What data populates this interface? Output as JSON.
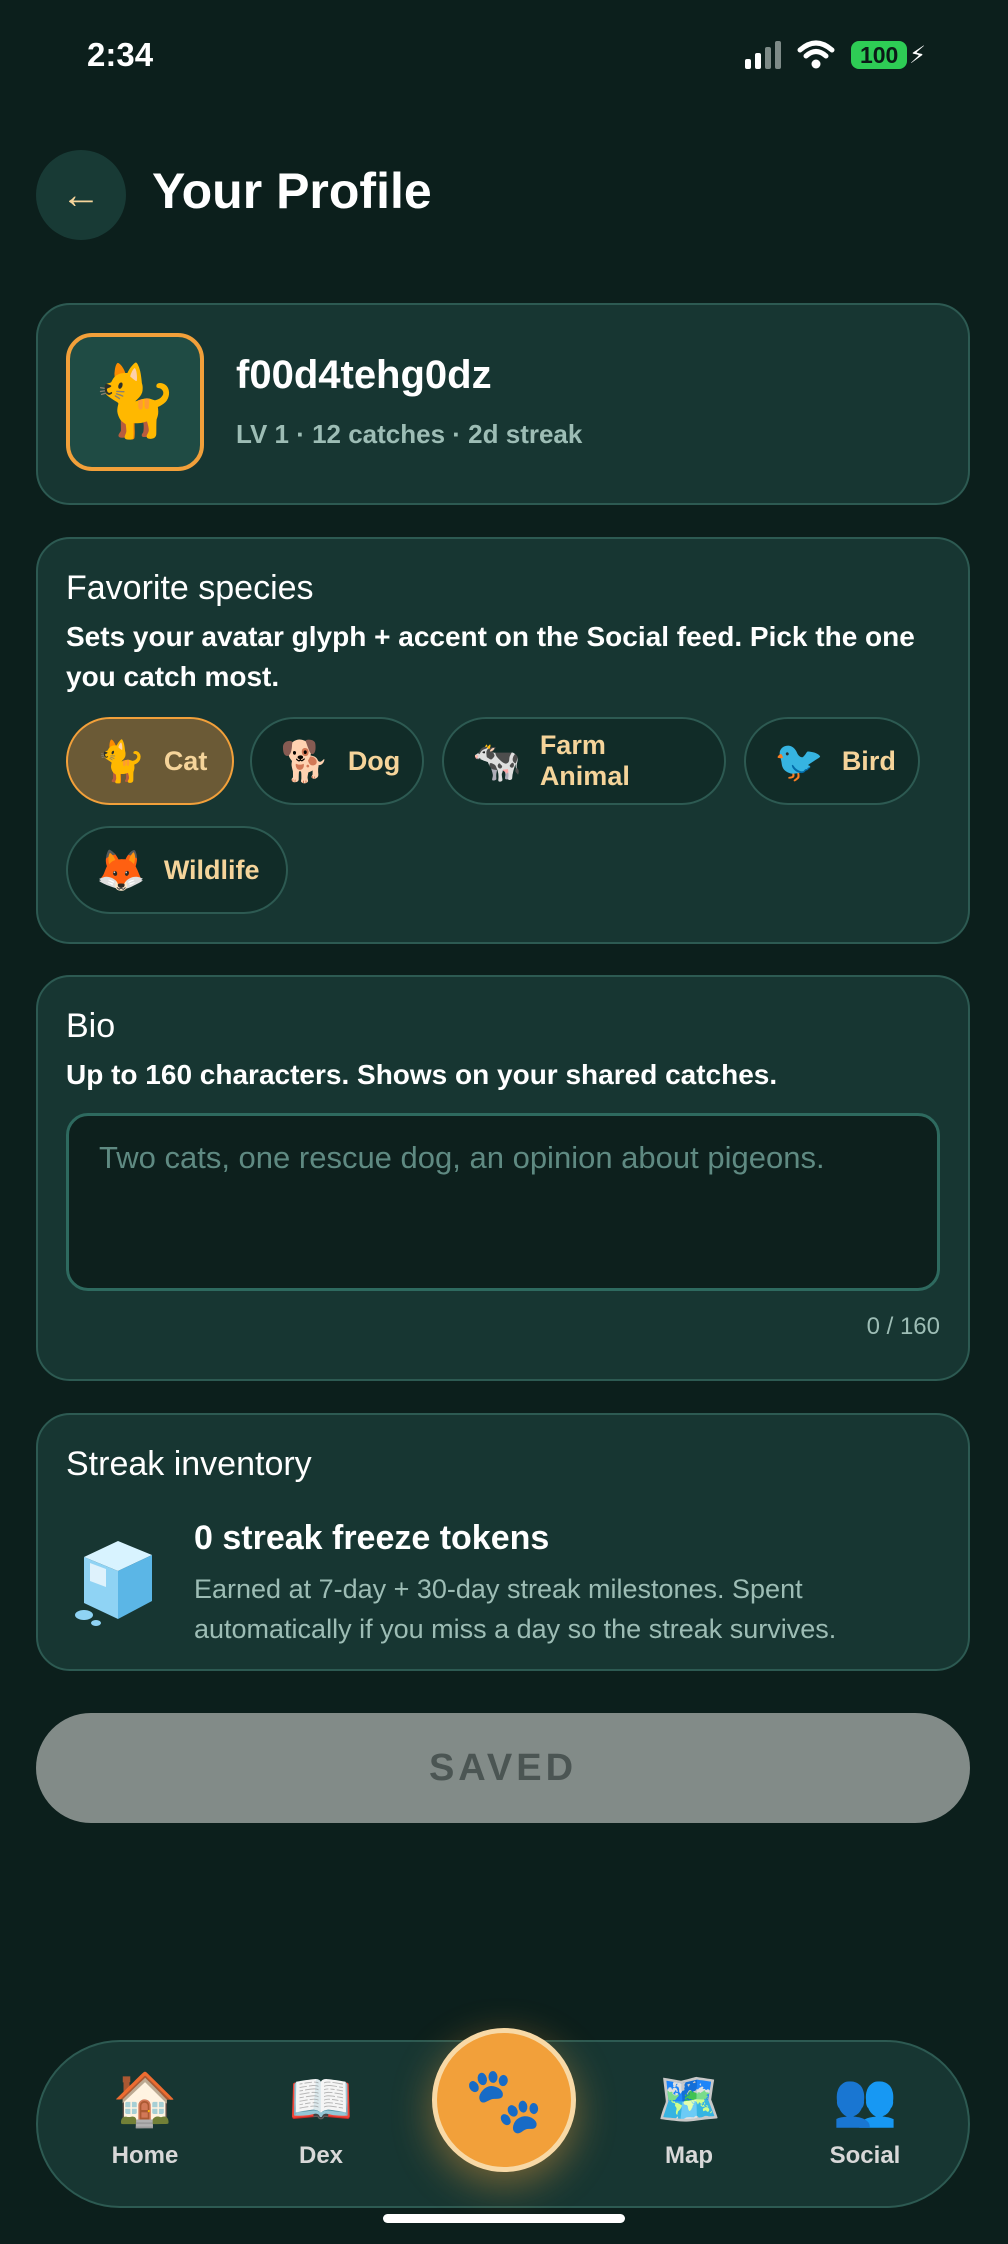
{
  "status_bar": {
    "time": "2:34",
    "battery": "100"
  },
  "header": {
    "back_icon": "←",
    "title": "Your Profile"
  },
  "profile": {
    "avatar": "🐈",
    "username": "f00d4tehg0dz",
    "stats": "LV 1 · 12 catches · 2d streak"
  },
  "favorite_species": {
    "title": "Favorite species",
    "subtitle": "Sets your avatar glyph + accent on the Social feed. Pick the one you catch most.",
    "options": [
      {
        "emoji": "🐈",
        "label": "Cat",
        "selected": true
      },
      {
        "emoji": "🐕",
        "label": "Dog",
        "selected": false
      },
      {
        "emoji": "🐄",
        "label": "Farm Animal",
        "selected": false
      },
      {
        "emoji": "🐦",
        "label": "Bird",
        "selected": false
      },
      {
        "emoji": "🦊",
        "label": "Wildlife",
        "selected": false
      }
    ]
  },
  "bio": {
    "title": "Bio",
    "subtitle": "Up to 160 characters. Shows on your shared catches.",
    "value": "",
    "placeholder": "Two cats, one rescue dog, an opinion about pigeons.",
    "counter": "0 / 160"
  },
  "streak_inventory": {
    "title": "Streak inventory",
    "tokens_title": "0 streak freeze tokens",
    "description": "Earned at 7-day + 30-day streak milestones. Spent automatically if you miss a day so the streak survives."
  },
  "save_button": {
    "label": "SAVED"
  },
  "nav": {
    "items": [
      {
        "icon": "🏠",
        "label": "Home"
      },
      {
        "icon": "📖",
        "label": "Dex"
      },
      {
        "icon": "🗺️",
        "label": "Map"
      },
      {
        "icon": "👥",
        "label": "Social"
      }
    ],
    "fab_icon": "🐾"
  },
  "colors": {
    "accent": "#f2a03a",
    "background": "#0c1f1c",
    "card": "#173632",
    "chip_text": "#f5d49a"
  }
}
